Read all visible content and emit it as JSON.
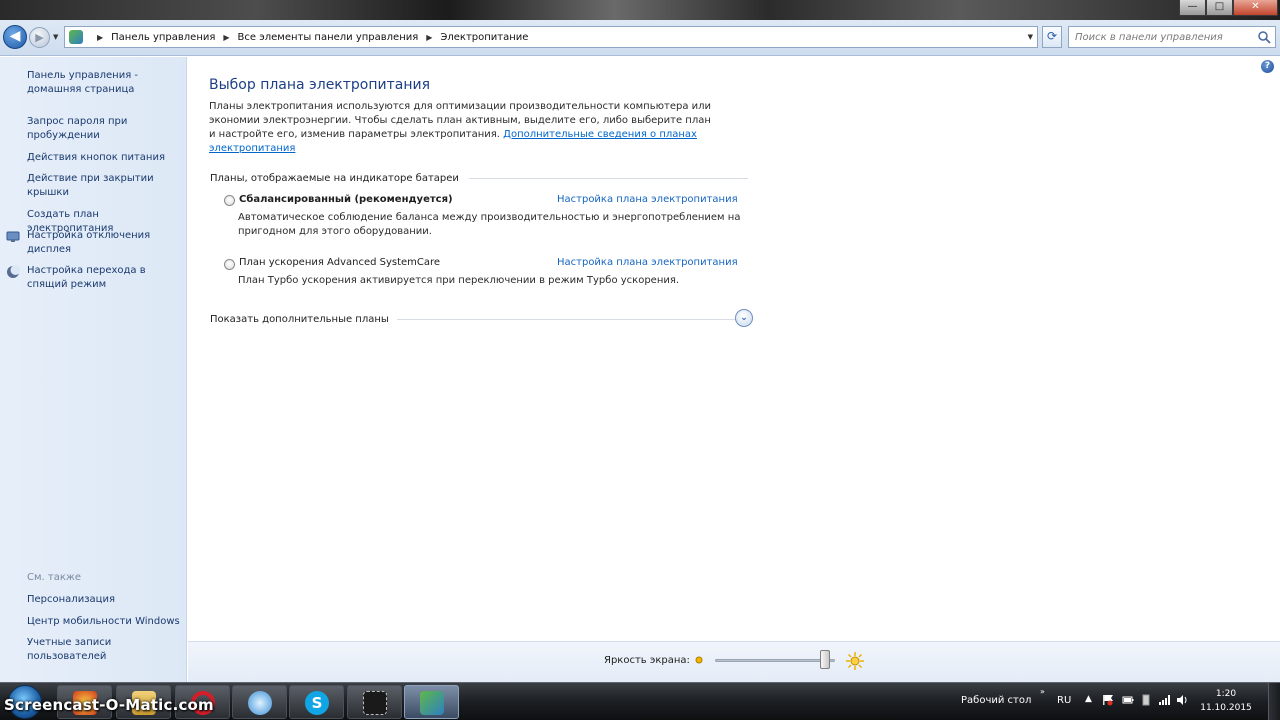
{
  "window": {
    "minimize": "—",
    "maximize": "□",
    "close": "✕"
  },
  "address": {
    "crumbs": [
      "Панель управления",
      "Все элементы панели управления",
      "Электропитание"
    ],
    "search_placeholder": "Поиск в панели управления"
  },
  "sidebar": {
    "items": [
      "Панель управления - домашняя страница",
      "Запрос пароля при пробуждении",
      "Действия кнопок питания",
      "Действие при закрытии крышки",
      "Создать план электропитания",
      "Настройка отключения дисплея",
      "Настройка перехода в спящий режим"
    ],
    "see_also_label": "См. также",
    "see_also": [
      "Персонализация",
      "Центр мобильности Windows",
      "Учетные записи пользователей"
    ]
  },
  "main": {
    "help": "?",
    "title": "Выбор плана электропитания",
    "description": "Планы электропитания используются для оптимизации производительности компьютера или экономии электроэнергии. Чтобы сделать план активным, выделите его, либо выберите план и настройте его, изменив параметры электропитания.",
    "description_link": "Дополнительные сведения о планах электропитания",
    "section_label": "Планы, отображаемые на индикаторе батареи",
    "plans": [
      {
        "name": "Сбалансированный (рекомендуется)",
        "link": "Настройка плана электропитания",
        "description": "Автоматическое соблюдение баланса между производительностью и энергопотреблением на пригодном для этого оборудовании."
      },
      {
        "name": "План ускорения Advanced SystemCare",
        "link": "Настройка плана электропитания",
        "description": "План Турбо ускорения активируется при переключении в режим Турбо ускорения."
      }
    ],
    "show_more": "Показать дополнительные планы"
  },
  "brightness": {
    "label": "Яркость экрана:",
    "level_percent": 95
  },
  "taskbar": {
    "watermark": "Screencast-O-Matic.com",
    "desktop_label": "Рабочий стол",
    "lang": "RU",
    "time": "1:20",
    "date": "11.10.2015"
  }
}
